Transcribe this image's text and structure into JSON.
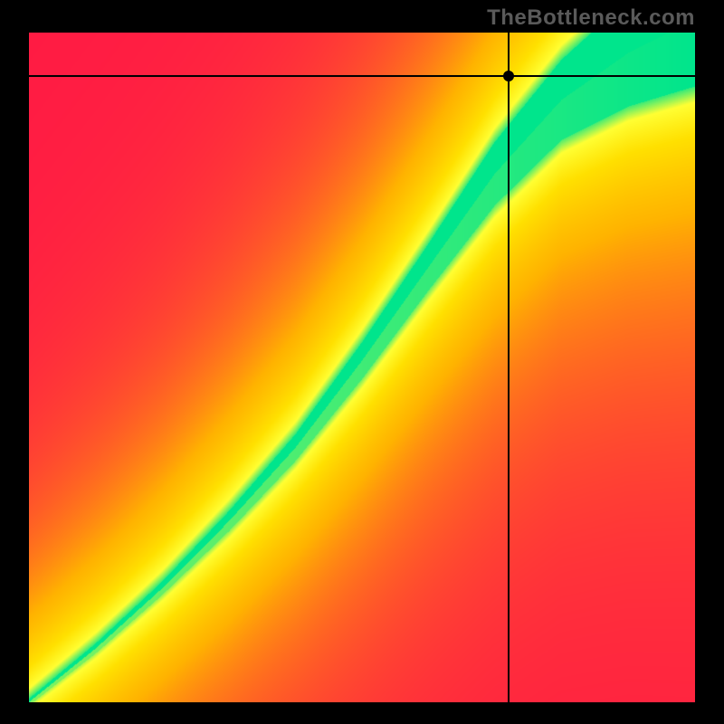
{
  "watermark_text": "TheBottleneck.com",
  "chart_data": {
    "type": "heatmap",
    "title": "",
    "xlabel": "",
    "ylabel": "",
    "xlim": [
      0,
      1
    ],
    "ylim": [
      0,
      1
    ],
    "legend": false,
    "grid": false,
    "crosshair": {
      "x": 0.72,
      "y": 0.935
    },
    "marker": {
      "x": 0.72,
      "y": 0.935
    },
    "ridge": {
      "description": "Center line of the optimal (green) band; value ~1 on ridge falling off with distance.",
      "points": [
        {
          "x": 0.0,
          "y": 0.0
        },
        {
          "x": 0.1,
          "y": 0.08
        },
        {
          "x": 0.2,
          "y": 0.17
        },
        {
          "x": 0.3,
          "y": 0.27
        },
        {
          "x": 0.4,
          "y": 0.38
        },
        {
          "x": 0.5,
          "y": 0.51
        },
        {
          "x": 0.6,
          "y": 0.65
        },
        {
          "x": 0.7,
          "y": 0.79
        },
        {
          "x": 0.8,
          "y": 0.9
        },
        {
          "x": 0.9,
          "y": 0.97
        },
        {
          "x": 1.0,
          "y": 1.02
        }
      ],
      "band_half_width": [
        {
          "x": 0.0,
          "w": 0.005
        },
        {
          "x": 0.2,
          "w": 0.01
        },
        {
          "x": 0.4,
          "w": 0.02
        },
        {
          "x": 0.6,
          "w": 0.035
        },
        {
          "x": 0.8,
          "w": 0.06
        },
        {
          "x": 1.0,
          "w": 0.1
        }
      ]
    },
    "colorscale": [
      {
        "value": 0.0,
        "color": "#ff1a44"
      },
      {
        "value": 0.5,
        "color": "#ffb300"
      },
      {
        "value": 0.75,
        "color": "#ffe000"
      },
      {
        "value": 0.9,
        "color": "#ffff33"
      },
      {
        "value": 1.0,
        "color": "#00e58c"
      }
    ]
  }
}
